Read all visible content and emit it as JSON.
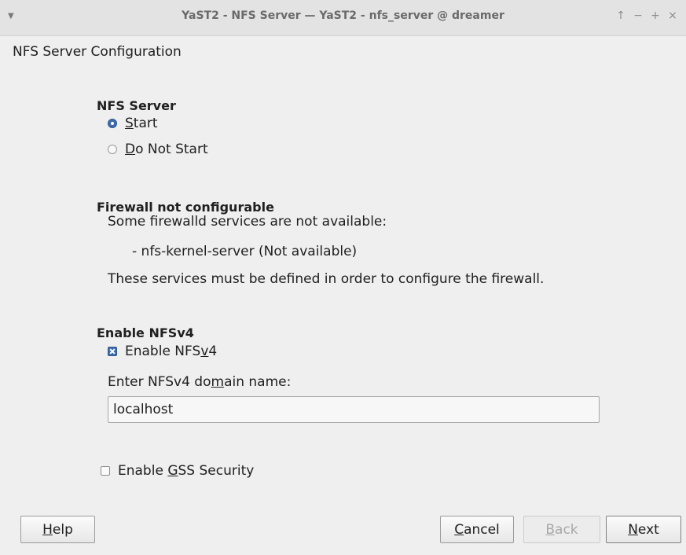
{
  "window": {
    "title": "YaST2 - NFS Server — YaST2 - nfs_server @ dreamer",
    "menu_icon": "triangle-down",
    "controls": [
      "↑",
      "−",
      "+",
      "×"
    ]
  },
  "page": {
    "heading": "NFS Server Configuration"
  },
  "nfs_server": {
    "title": "NFS Server",
    "start": {
      "u": "S",
      "rest": "tart"
    },
    "do_not_start": {
      "u": "D",
      "rest": "o Not Start"
    },
    "selected": "start"
  },
  "firewall": {
    "title": "Firewall not configurable",
    "line1": "Some firewalld services are not available:",
    "line2": "- nfs-kernel-server (Not available)",
    "line3": "These services must be defined in order to configure the firewall."
  },
  "nfsv4": {
    "title": "Enable NFSv4",
    "checkbox": {
      "pre": "Enable NFS",
      "u": "v",
      "post": "4",
      "checked": true
    },
    "domain_label": {
      "pre": "Enter NFSv4 do",
      "u": "m",
      "post": "ain name:"
    },
    "domain_value": "localhost"
  },
  "gss": {
    "pre": "Enable ",
    "u": "G",
    "post": "SS Security",
    "checked": false
  },
  "buttons": {
    "help": {
      "u": "H",
      "rest": "elp"
    },
    "cancel": {
      "u": "C",
      "rest": "ancel"
    },
    "back": {
      "u": "B",
      "rest": "ack",
      "enabled": false
    },
    "next": {
      "u": "N",
      "rest": "ext"
    }
  }
}
